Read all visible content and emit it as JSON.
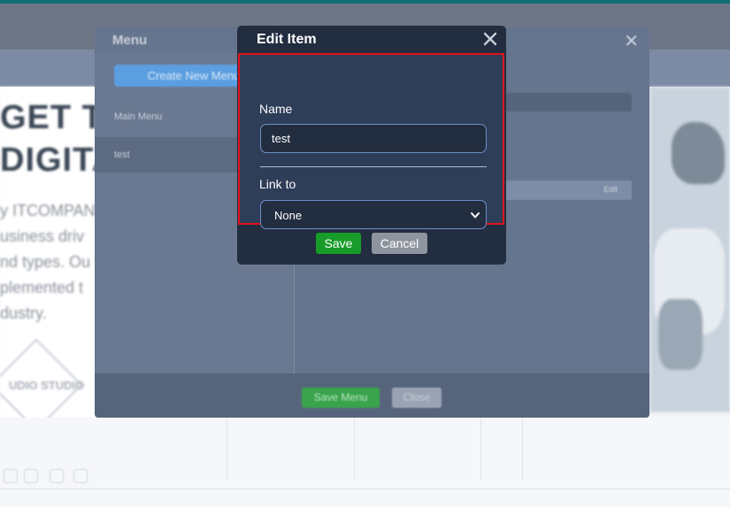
{
  "background_page": {
    "hero_title_lines": [
      "GET TO",
      "DIGITAL"
    ],
    "hero_text_lines": [
      "y ITCOMPANY",
      "usiness driv",
      "nd types. Ou",
      "plemented t",
      "dustry."
    ],
    "logo_text": "UDIO STUDIO"
  },
  "menu_dialog": {
    "title": "Menu",
    "create_button_label": "Create New Menu",
    "menus": [
      {
        "label": "Main Menu",
        "selected": false
      },
      {
        "label": "test",
        "selected": true
      }
    ],
    "row_action": "Edit",
    "save_button_label": "Save Menu",
    "close_button_label": "Close"
  },
  "edit_item": {
    "title": "Edit Item",
    "name_label": "Name",
    "name_value": "test",
    "link_label": "Link to",
    "link_selected": "None",
    "save_label": "Save",
    "cancel_label": "Cancel"
  },
  "icons": {
    "close": "close-icon",
    "select_caret": "chevron-down-icon"
  },
  "colors": {
    "modal_bg": "#222d40",
    "modal_body_bg": "#2e3d58",
    "highlight_border": "#e1121b",
    "save_green": "#179c2a",
    "cancel_gray": "#8e959f",
    "input_border": "#6f8fc8"
  }
}
